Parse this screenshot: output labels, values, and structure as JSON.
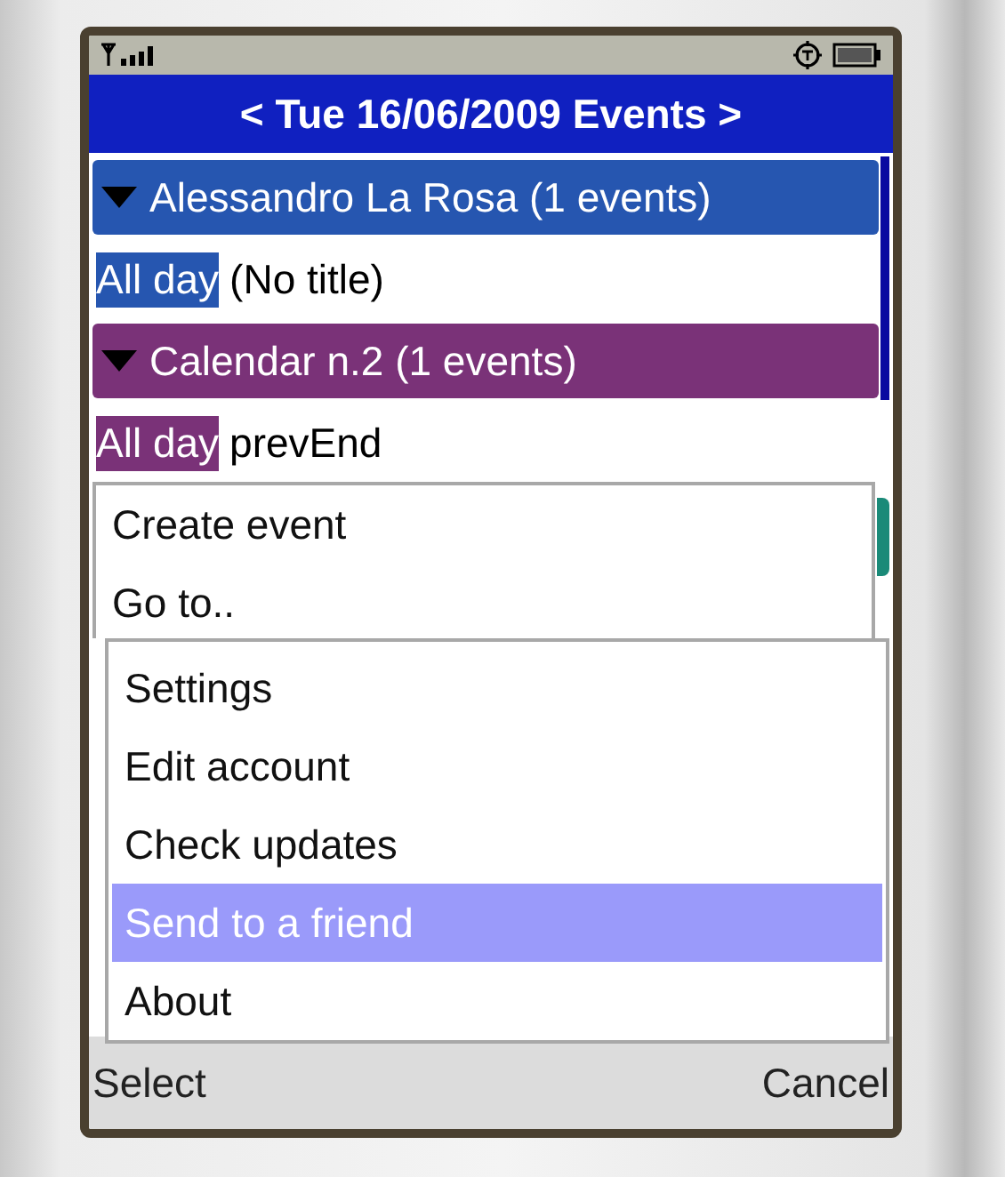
{
  "title": "< Tue 16/06/2009 Events >",
  "groups": [
    {
      "name": "Alessandro La Rosa (1 events)",
      "color": "#2656b0",
      "expanded": true,
      "events": [
        {
          "time": "All day",
          "title": "(No title)"
        }
      ]
    },
    {
      "name": "Calendar n.2 (1 events)",
      "color": "#7a3278",
      "expanded": true,
      "events": [
        {
          "time": "All day",
          "title": "prevEnd"
        }
      ]
    }
  ],
  "menu": {
    "items": [
      {
        "label": "Create event",
        "selected": false
      },
      {
        "label": "Go to..",
        "selected": false
      }
    ]
  },
  "submenu": {
    "items": [
      {
        "label": "Settings",
        "selected": false
      },
      {
        "label": "Edit account",
        "selected": false
      },
      {
        "label": "Check updates",
        "selected": false
      },
      {
        "label": "Send to a friend",
        "selected": true
      },
      {
        "label": "About",
        "selected": false
      }
    ]
  },
  "softkeys": {
    "left": "Select",
    "right": "Cancel"
  }
}
